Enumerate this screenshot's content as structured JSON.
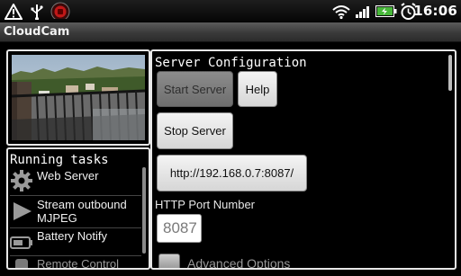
{
  "status_bar": {
    "time": "16:06",
    "icons": [
      "warning-icon",
      "usb-icon",
      "app-notification-icon",
      "wifi-icon",
      "signal-icon",
      "battery-charging-icon",
      "alarm-icon"
    ]
  },
  "app": {
    "title": "CloudCam"
  },
  "camera": {
    "preview_icon": "camera-preview-image"
  },
  "tasks": {
    "title": "Running tasks",
    "items": [
      {
        "label": "Web Server",
        "icon": "gear-icon"
      },
      {
        "label": "Stream outbound MJPEG",
        "icon": "play-icon"
      },
      {
        "label": "Battery Notify",
        "icon": "battery-icon"
      },
      {
        "label": "Remote Control",
        "icon": "remote-icon"
      }
    ]
  },
  "config": {
    "title": "Server Configuration",
    "start_label": "Start Server",
    "help_label": "Help",
    "stop_label": "Stop Server",
    "url_label": "http://192.168.0.7:8087/",
    "port_label": "HTTP Port Number",
    "port_value": "8087",
    "advanced_label": "Advanced Options"
  },
  "colors": {
    "background": "#000000",
    "panel_border": "#e8e8e8",
    "button_light": "#e6e6e6",
    "button_disabled": "#7a7a7a"
  }
}
